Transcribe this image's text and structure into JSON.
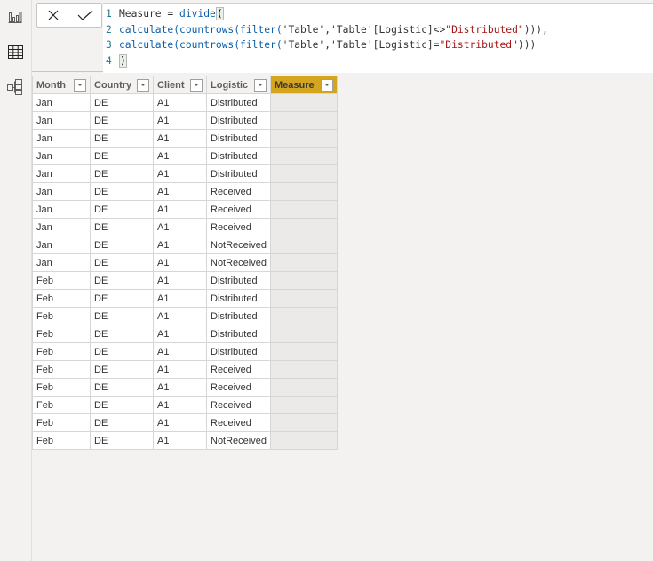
{
  "sidebar": {
    "items": [
      {
        "name": "report-view",
        "icon": "bar-chart-icon"
      },
      {
        "name": "data-view",
        "icon": "table-icon"
      },
      {
        "name": "model-view",
        "icon": "model-icon"
      }
    ]
  },
  "formula_bar": {
    "cancel_icon": "close-icon",
    "commit_icon": "check-icon",
    "lines": [
      {
        "num": "1",
        "parts": [
          {
            "t": "Measure = ",
            "c": "plain"
          },
          {
            "t": "divide",
            "c": "kw"
          },
          {
            "t": "(",
            "c": "bracket"
          }
        ]
      },
      {
        "num": "2",
        "parts": [
          {
            "t": "calculate(countrows(filter(",
            "c": "kw"
          },
          {
            "t": "'Table','Table'[Logistic]<>",
            "c": "plain"
          },
          {
            "t": "\"Distributed\"",
            "c": "str"
          },
          {
            "t": "))),",
            "c": "plain"
          }
        ]
      },
      {
        "num": "3",
        "parts": [
          {
            "t": "calculate(countrows(filter(",
            "c": "kw"
          },
          {
            "t": "'Table','Table'[Logistic]=",
            "c": "plain"
          },
          {
            "t": "\"Distributed\"",
            "c": "str"
          },
          {
            "t": ")))",
            "c": "plain"
          }
        ]
      },
      {
        "num": "4",
        "parts": [
          {
            "t": ")",
            "c": "bracket"
          }
        ]
      }
    ]
  },
  "table": {
    "columns": [
      "Month",
      "Country",
      "Client",
      "Logistic",
      "Measure"
    ],
    "selected_column": "Measure",
    "accent_color": "#d4a51f",
    "rows": [
      [
        "Jan",
        "DE",
        "A1",
        "Distributed",
        ""
      ],
      [
        "Jan",
        "DE",
        "A1",
        "Distributed",
        ""
      ],
      [
        "Jan",
        "DE",
        "A1",
        "Distributed",
        ""
      ],
      [
        "Jan",
        "DE",
        "A1",
        "Distributed",
        ""
      ],
      [
        "Jan",
        "DE",
        "A1",
        "Distributed",
        ""
      ],
      [
        "Jan",
        "DE",
        "A1",
        "Received",
        ""
      ],
      [
        "Jan",
        "DE",
        "A1",
        "Received",
        ""
      ],
      [
        "Jan",
        "DE",
        "A1",
        "Received",
        ""
      ],
      [
        "Jan",
        "DE",
        "A1",
        "NotReceived",
        ""
      ],
      [
        "Jan",
        "DE",
        "A1",
        "NotReceived",
        ""
      ],
      [
        "Feb",
        "DE",
        "A1",
        "Distributed",
        ""
      ],
      [
        "Feb",
        "DE",
        "A1",
        "Distributed",
        ""
      ],
      [
        "Feb",
        "DE",
        "A1",
        "Distributed",
        ""
      ],
      [
        "Feb",
        "DE",
        "A1",
        "Distributed",
        ""
      ],
      [
        "Feb",
        "DE",
        "A1",
        "Distributed",
        ""
      ],
      [
        "Feb",
        "DE",
        "A1",
        "Received",
        ""
      ],
      [
        "Feb",
        "DE",
        "A1",
        "Received",
        ""
      ],
      [
        "Feb",
        "DE",
        "A1",
        "Received",
        ""
      ],
      [
        "Feb",
        "DE",
        "A1",
        "Received",
        ""
      ],
      [
        "Feb",
        "DE",
        "A1",
        "NotReceived",
        ""
      ]
    ]
  }
}
